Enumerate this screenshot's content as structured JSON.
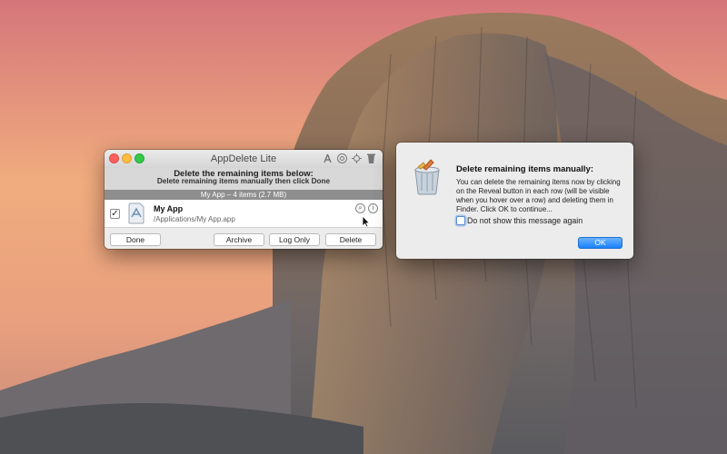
{
  "desktop": {
    "wallpaper": "yosemite-el-capitan"
  },
  "main_window": {
    "title": "AppDelete Lite",
    "toolbar_icons": [
      "app-store-icon",
      "help-icon",
      "settings-icon",
      "trash-icon"
    ],
    "instruction_line1": "Delete the remaining items below:",
    "instruction_line2": "Delete remaining items manually then click Done",
    "group_header": "My App – 4 items (2.7 MB)",
    "row": {
      "checked": true,
      "check_glyph": "✓",
      "name": "My App",
      "path": "/Applications/My App.app",
      "reveal_glyph": "⌕",
      "info_glyph": "i"
    },
    "buttons": {
      "done": "Done",
      "archive": "Archive",
      "log_only": "Log Only",
      "delete": "Delete"
    }
  },
  "alert": {
    "title": "Delete remaining items manually:",
    "body": "You can delete the remaining items now by clicking on the Reveal button in each row (will be visible when you hover over a row) and deleting them in Finder. Click OK to continue...",
    "checkbox_label": "Do not show this message again",
    "ok_label": "OK"
  },
  "colors": {
    "accent": "#1a82fb",
    "close": "#fc605b",
    "minimize": "#fdbc40",
    "maximize": "#34c84a"
  }
}
